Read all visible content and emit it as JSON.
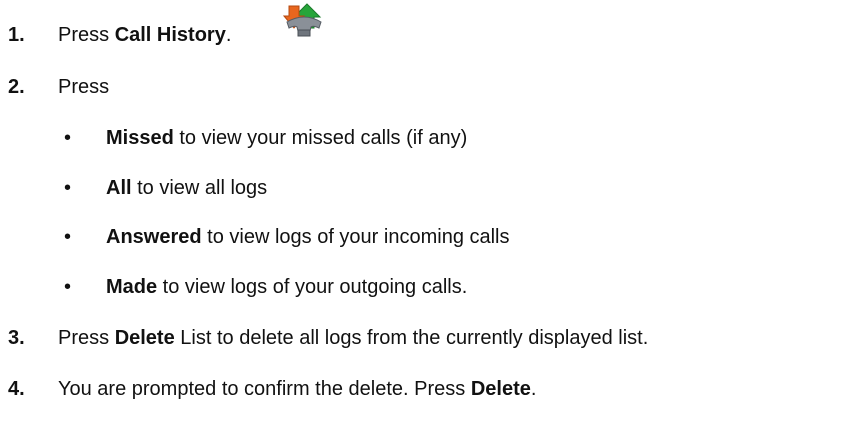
{
  "steps": [
    {
      "num": "1.",
      "text": "Press ",
      "bold": "Call History",
      "after": "."
    },
    {
      "num": "2.",
      "text": "Press"
    },
    {
      "num": "3.",
      "bold": "Delete",
      "after": " List to delete all logs from the currently displayed list.",
      "before": "Press "
    },
    {
      "num": "4.",
      "before": "You are prompted to confirm the delete. Press ",
      "bold": "Delete",
      "after": "."
    }
  ],
  "bullets": [
    {
      "symbol": "•",
      "bold": "Missed",
      "text": " to view your missed calls (if any)"
    },
    {
      "symbol": "•",
      "bold": "All",
      "text": " to view all logs"
    },
    {
      "symbol": "•",
      "bold": "Answered",
      "text": " to view logs of your incoming calls"
    },
    {
      "symbol": "•",
      "bold": "Made",
      "text": " to view logs of your outgoing calls."
    }
  ],
  "icon": {
    "name": "call-history-icon",
    "colors": {
      "orange": "#e8661e",
      "green": "#27a53a",
      "gray": "#8a9098"
    }
  }
}
